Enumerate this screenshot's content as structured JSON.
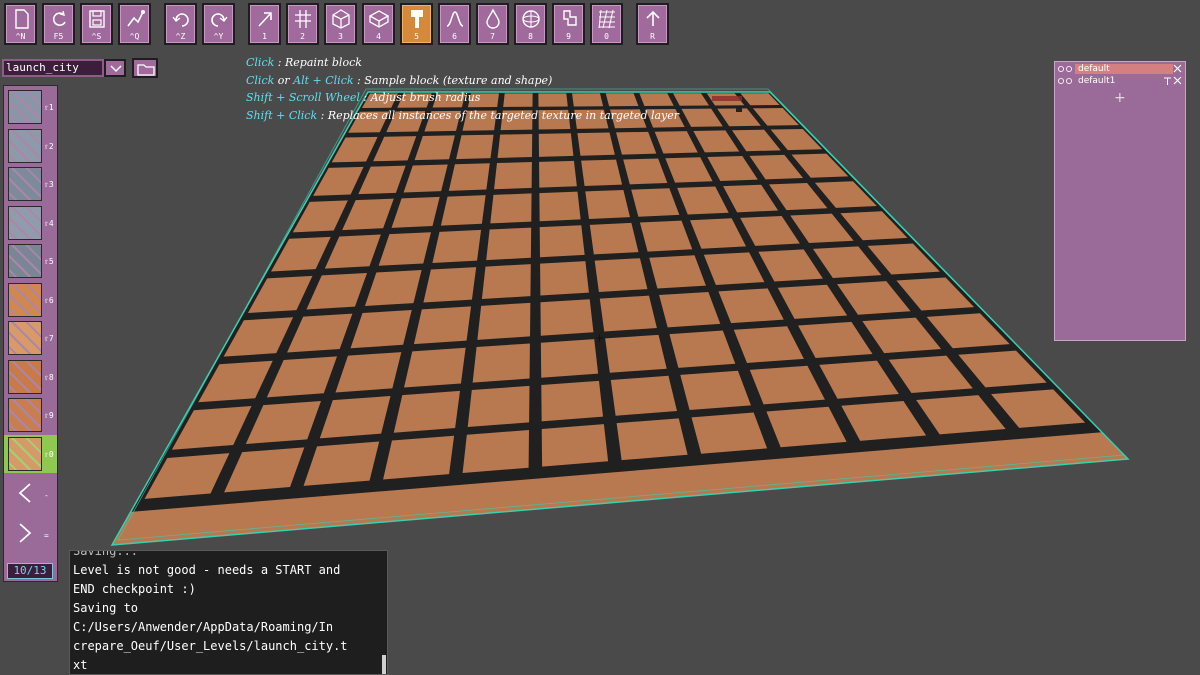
{
  "toolbar": {
    "buttons": [
      {
        "key": "^N",
        "icon": "new-file-icon"
      },
      {
        "key": "F5",
        "icon": "reload-icon"
      },
      {
        "key": "^S",
        "icon": "save-icon"
      },
      {
        "key": "^Q",
        "icon": "play-icon"
      },
      {
        "key": "^Z",
        "icon": "undo-icon"
      },
      {
        "key": "^Y",
        "icon": "redo-icon"
      },
      {
        "key": "1",
        "icon": "arrow-tool-icon"
      },
      {
        "key": "2",
        "icon": "grid-tool-icon"
      },
      {
        "key": "3",
        "icon": "cube-tool-icon"
      },
      {
        "key": "4",
        "icon": "block-tool-icon"
      },
      {
        "key": "5",
        "icon": "paint-brush-icon",
        "active": true
      },
      {
        "key": "6",
        "icon": "curve-tool-icon"
      },
      {
        "key": "7",
        "icon": "drop-tool-icon"
      },
      {
        "key": "8",
        "icon": "sphere-tool-icon"
      },
      {
        "key": "9",
        "icon": "stamp-tool-icon"
      },
      {
        "key": "0",
        "icon": "texture-grid-icon"
      },
      {
        "key": "R",
        "icon": "raise-arrow-icon"
      }
    ]
  },
  "level": {
    "name": "launch_city"
  },
  "help": {
    "line1_key": "Click",
    "line1_text": " : Repaint block",
    "line2_key1": "Click",
    "line2_or": " or ",
    "line2_key2": "Alt + Click",
    "line2_text": " : Sample block (texture and shape)",
    "line3_key": "Shift + Scroll Wheel",
    "line3_text": " : Adjust brush radius",
    "line4_key": "Shift + Click",
    "line4_text": " : Replaces all instances of the targeted texture in targeted layer"
  },
  "palette": {
    "slots": [
      {
        "key": "⇧1",
        "color": "#8a96a8"
      },
      {
        "key": "⇧2",
        "color": "#8e9aaa"
      },
      {
        "key": "⇧3",
        "color": "#7c8a9c"
      },
      {
        "key": "⇧4",
        "color": "#909cac"
      },
      {
        "key": "⇧5",
        "color": "#7a8696"
      },
      {
        "key": "⇧6",
        "color": "#d08850"
      },
      {
        "key": "⇧7",
        "color": "#d89a68"
      },
      {
        "key": "⇧8",
        "color": "#c87a48"
      },
      {
        "key": "⇧9",
        "color": "#c87e50"
      },
      {
        "key": "⇧0",
        "color": "#d49a6a",
        "selected": true
      }
    ],
    "prev_key": "-",
    "next_key": "=",
    "page": "10/13"
  },
  "layers": {
    "items": [
      {
        "name": "default",
        "selected": true
      },
      {
        "name": "default1",
        "selected": false
      }
    ],
    "add_label": "+"
  },
  "console": {
    "lines": [
      "Saving...",
      "Level is not good - needs a START and",
      "END checkpoint :)",
      "Saving to",
      "C:/Users/Anwender/AppData/Roaming/In",
      "crepare_Oeuf/User_Levels/launch_city.t",
      "xt"
    ]
  }
}
